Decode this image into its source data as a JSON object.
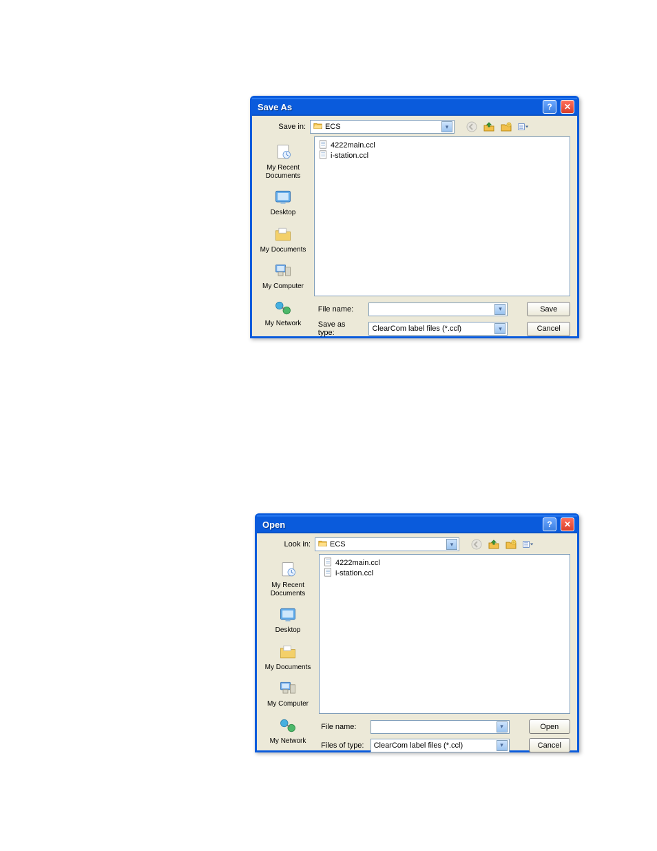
{
  "dialogs": {
    "save": {
      "title": "Save As",
      "location_label": "Save in:",
      "folder_name": "ECS",
      "files": [
        "4222main.ccl",
        "i-station.ccl"
      ],
      "filename_label": "File name:",
      "filename_value": "",
      "type_label": "Save as type:",
      "type_value": "ClearCom label files (*.ccl)",
      "primary_action": "Save",
      "cancel_action": "Cancel"
    },
    "open": {
      "title": "Open",
      "location_label": "Look in:",
      "folder_name": "ECS",
      "files": [
        "4222main.ccl",
        "i-station.ccl"
      ],
      "filename_label": "File name:",
      "filename_value": "",
      "type_label": "Files of type:",
      "type_value": "ClearCom label files (*.ccl)",
      "primary_action": "Open",
      "cancel_action": "Cancel"
    }
  },
  "places": [
    "My Recent Documents",
    "Desktop",
    "My Documents",
    "My Computer",
    "My Network"
  ]
}
